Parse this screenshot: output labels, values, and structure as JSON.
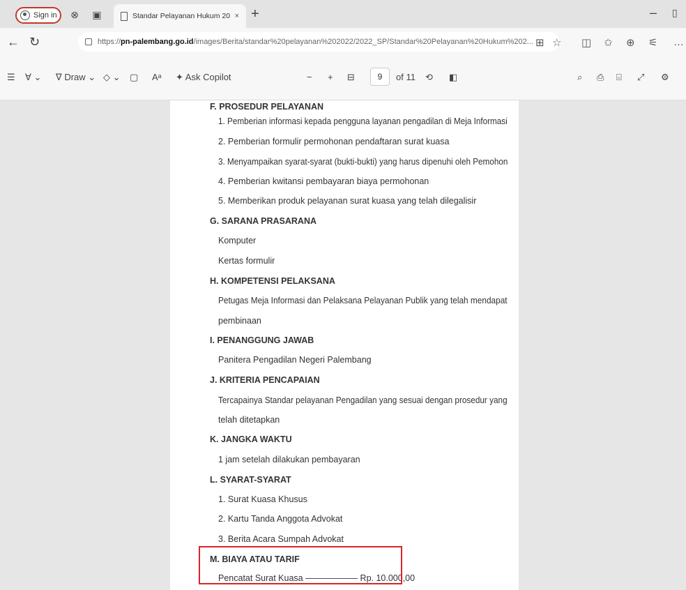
{
  "browser": {
    "signin_label": "Sign in",
    "tab_title": "Standar Pelayanan Hukum 202...",
    "tab_close": "×",
    "new_tab": "+",
    "url_prefix": "https://",
    "url_host": "pn-palembang.go.id",
    "url_path": "/images/Berita/standar%20pelayanan%202022/2022_SP/Standar%20Pelayanan%20Hukum%202..."
  },
  "pdf_toolbar": {
    "draw_label": "Draw",
    "ask_copilot_label": "Ask Copilot",
    "zoom_out": "−",
    "zoom_in": "+",
    "current_page": "9",
    "page_total": "of 11"
  },
  "document": {
    "lines": [
      "F. PROSEDUR PELAYANAN",
      "1. Pemberian informasi kepada pengguna layanan pengadilan di Meja Informasi",
      "2. Pemberian formulir permohonan pendaftaran surat kuasa",
      "3. Menyampaikan syarat-syarat (bukti-bukti) yang harus dipenuhi oleh Pemohon",
      "4. Pemberian kwitansi pembayaran biaya permohonan",
      "5. Memberikan produk pelayanan surat kuasa yang telah dilegalisir",
      "G. SARANA PRASARANA",
      "Komputer",
      "Kertas formulir",
      "H. KOMPETENSI PELAKSANA",
      "Petugas Meja Informasi dan Pelaksana Pelayanan Publik yang telah mendapat",
      "pembinaan",
      "I. PENANGGUNG JAWAB",
      "Panitera Pengadilan Negeri Palembang",
      "J. KRITERIA PENCAPAIAN",
      "Tercapainya Standar pelayanan Pengadilan yang sesuai dengan prosedur yang",
      "telah ditetapkan",
      "K. JANGKA WAKTU",
      "1 jam setelah dilakukan pembayaran",
      "L. SYARAT-SYARAT",
      "1. Surat Kuasa Khusus",
      "2. Kartu Tanda Anggota Advokat",
      "3. Berita Acara Sumpah Advokat",
      "M. BIAYA ATAU TARIF",
      "Pencatat Surat Kuasa —————— Rp. 10.000,00"
    ]
  },
  "colors": {
    "highlight_box": "#d9232b",
    "signin_border": "#c0392b"
  }
}
